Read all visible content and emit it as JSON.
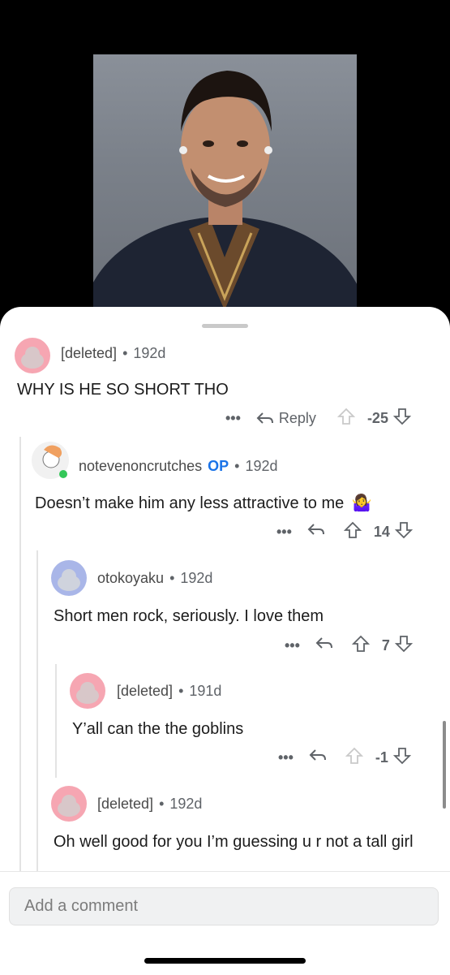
{
  "comments": [
    {
      "user": "[deleted]",
      "age": "192d",
      "body": "WHY IS HE SO SHORT THO",
      "more": "•••",
      "reply_label": "Reply",
      "score": "-25"
    },
    {
      "user": "notevenoncrutches",
      "op": "OP",
      "age": "192d",
      "body": "Doesn’t make him any less attractive to me",
      "emoji": "🤷‍♀️",
      "more": "•••",
      "score": "14"
    },
    {
      "user": "otokoyaku",
      "age": "192d",
      "body": "Short men rock, seriously. I love them",
      "more": "•••",
      "score": "7"
    },
    {
      "user": "[deleted]",
      "age": "191d",
      "body": "Y’all can the the goblins",
      "more": "•••",
      "score": "-1"
    },
    {
      "user": "[deleted]",
      "age": "192d",
      "body": "Oh well good for you I’m guessing u r not a tall girl"
    }
  ],
  "meta_separator": "•",
  "composer": {
    "placeholder": "Add a comment"
  },
  "colors": {
    "accent": "#1a73e8",
    "upvote_active": "#5f6368",
    "avatar_pink": "#f6a6b2",
    "avatar_blue": "#a9b6e8"
  }
}
